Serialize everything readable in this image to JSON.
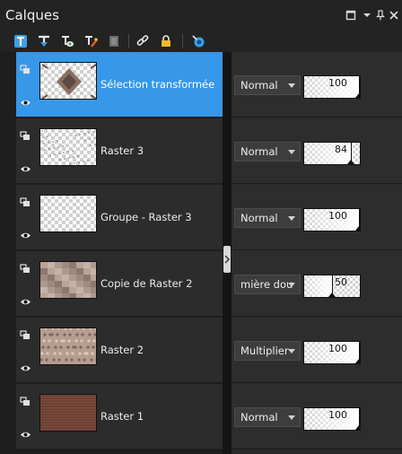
{
  "panel": {
    "title": "Calques",
    "window_buttons": [
      "restore-icon",
      "dropdown-icon",
      "pin-icon",
      "close-icon"
    ]
  },
  "toolbar": {
    "icons": [
      "new-raster-layer-icon",
      "new-vector-layer-icon",
      "new-mask-layer-icon",
      "new-adjustment-layer-icon",
      "delete-layer-icon",
      "link-icon",
      "lock-icon",
      "visibility-toggle-icon"
    ]
  },
  "layers": [
    {
      "name": "Sélection transformée",
      "blend": "Normal",
      "opacity": "100",
      "opacity_level": 1.0,
      "selected": true,
      "thumb": "diamond"
    },
    {
      "name": "Raster 3",
      "blend": "Normal",
      "opacity": "84",
      "opacity_level": 0.84,
      "selected": false,
      "thumb": "dots"
    },
    {
      "name": "Groupe - Raster 3",
      "blend": "Normal",
      "opacity": "100",
      "opacity_level": 1.0,
      "selected": false,
      "thumb": "empty"
    },
    {
      "name": "Copie de Raster 2",
      "blend": "mière dou",
      "opacity": "50",
      "opacity_level": 0.5,
      "selected": false,
      "thumb": "mosaic"
    },
    {
      "name": "Raster 2",
      "blend": "Multiplier",
      "opacity": "100",
      "opacity_level": 1.0,
      "selected": false,
      "thumb": "lace"
    },
    {
      "name": "Raster 1",
      "blend": "Normal",
      "opacity": "100",
      "opacity_level": 1.0,
      "selected": false,
      "thumb": "brick"
    }
  ],
  "colors": {
    "selected_row": "#3797e8",
    "panel_bg": "#2c2c2c",
    "thumb_brown": "#7a4a3c",
    "thumb_mosaic": "#a08a7c"
  }
}
